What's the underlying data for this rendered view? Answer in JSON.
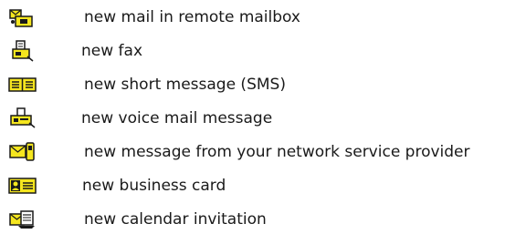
{
  "legend": {
    "items": [
      {
        "icon": "remote-mailbox-icon",
        "label": "new mail in remote mailbox"
      },
      {
        "icon": "fax-icon",
        "label": "new fax"
      },
      {
        "icon": "sms-icon",
        "label": "new short message (SMS)"
      },
      {
        "icon": "voice-mail-icon",
        "label": "new voice mail message"
      },
      {
        "icon": "service-message-icon",
        "label": "new message from your network service provider"
      },
      {
        "icon": "business-card-icon",
        "label": "new business card"
      },
      {
        "icon": "calendar-invitation-icon",
        "label": "new calendar invitation"
      }
    ]
  },
  "colors": {
    "icon_fill": "#f5e61e",
    "icon_outline": "#1a1a1a",
    "text": "#1a1a1a",
    "background": "#ffffff"
  }
}
